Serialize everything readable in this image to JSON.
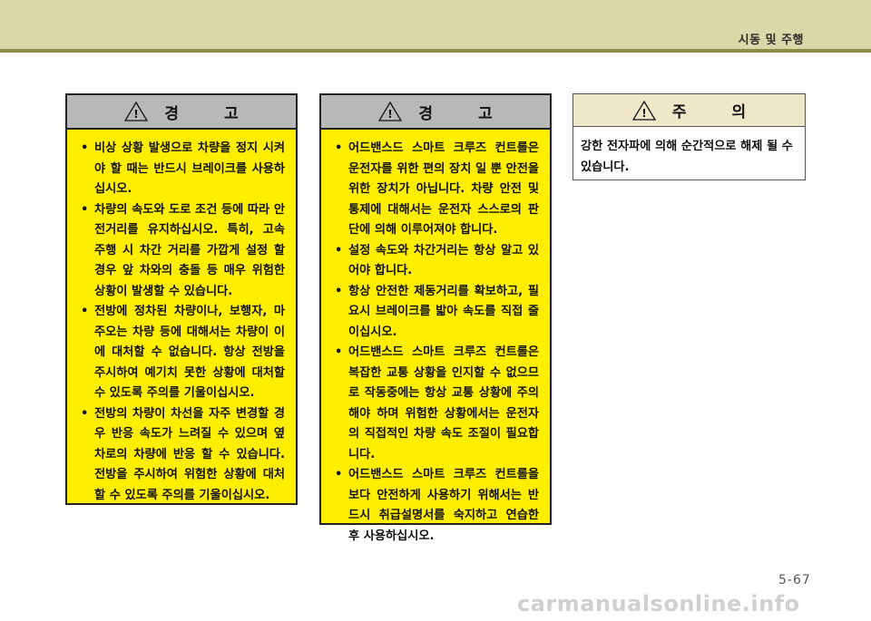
{
  "header": {
    "section_title": "시동 및 주행"
  },
  "boxes": [
    {
      "heading": "경 고",
      "items": [
        "비상 상황 발생으로 차량을 정지 시켜야 할 때는 반드시 브레이크를 사용하십시오.",
        "차량의 속도와 도로 조건 등에 따라 안전거리를 유지하십시오. 특히, 고속 주행 시 차간 거리를 가깝게 설정 할 경우 앞 차와의 충돌 등 매우 위험한 상황이 발생할 수 있습니다.",
        "전방에 정차된 차량이나, 보행자, 마주오는 차량 등에 대해서는 차량이 이에 대처할 수 없습니다. 항상 전방을 주시하여 예기치 못한 상황에 대처할 수 있도록 주의를 기울이십시오.",
        "전방의 차량이 차선을 자주 변경할 경우 반응 속도가 느려질 수 있으며 옆 차로의 차량에 반응 할 수 있습니다. 전방을 주시하여 위험한 상황에 대처할 수 있도록 주의를 기울이십시오."
      ]
    },
    {
      "heading": "경 고",
      "items": [
        "어드밴스드 스마트 크루즈 컨트롤은 운전자를 위한 편의 장치 일 뿐 안전을 위한 장치가 아닙니다. 차량 안전 및 통제에 대해서는 운전자 스스로의 판단에 의해 이루어져야 합니다.",
        "설정 속도와 차간거리는 항상 알고 있어야 합니다.",
        "항상 안전한 제동거리를 확보하고, 필요시 브레이크를 밟아 속도를 직접 줄이십시오.",
        "어드밴스드 스마트 크루즈 컨트롤은 복잡한 교통 상황을 인지할 수 없으므로 작동중에는 항상 교통 상황에 주의해야 하며 위험한 상황에서는 운전자의 직접적인 차량 속도 조절이 필요합니다.",
        "어드밴스드 스마트 크루즈 컨트롤을 보다 안전하게 사용하기 위해서는 반드시 취급설명서를 숙지하고 연습한 후 사용하십시오."
      ]
    },
    {
      "heading": "주 의",
      "text": "강한 전자파에 의해 순간적으로 해제 될 수 있습니다."
    }
  ],
  "bullet_glyph": "•",
  "warning_icon_glyph": "!",
  "footer": {
    "page_number": "5-67",
    "watermark": "carmanualsonline.info"
  },
  "colors": {
    "header_band": "#d8d8a8",
    "header_rule": "#8e8e4a",
    "warning_fill": "#ffee00",
    "warning_head": "#b8b8b8",
    "caution_head": "#efe8c8"
  }
}
